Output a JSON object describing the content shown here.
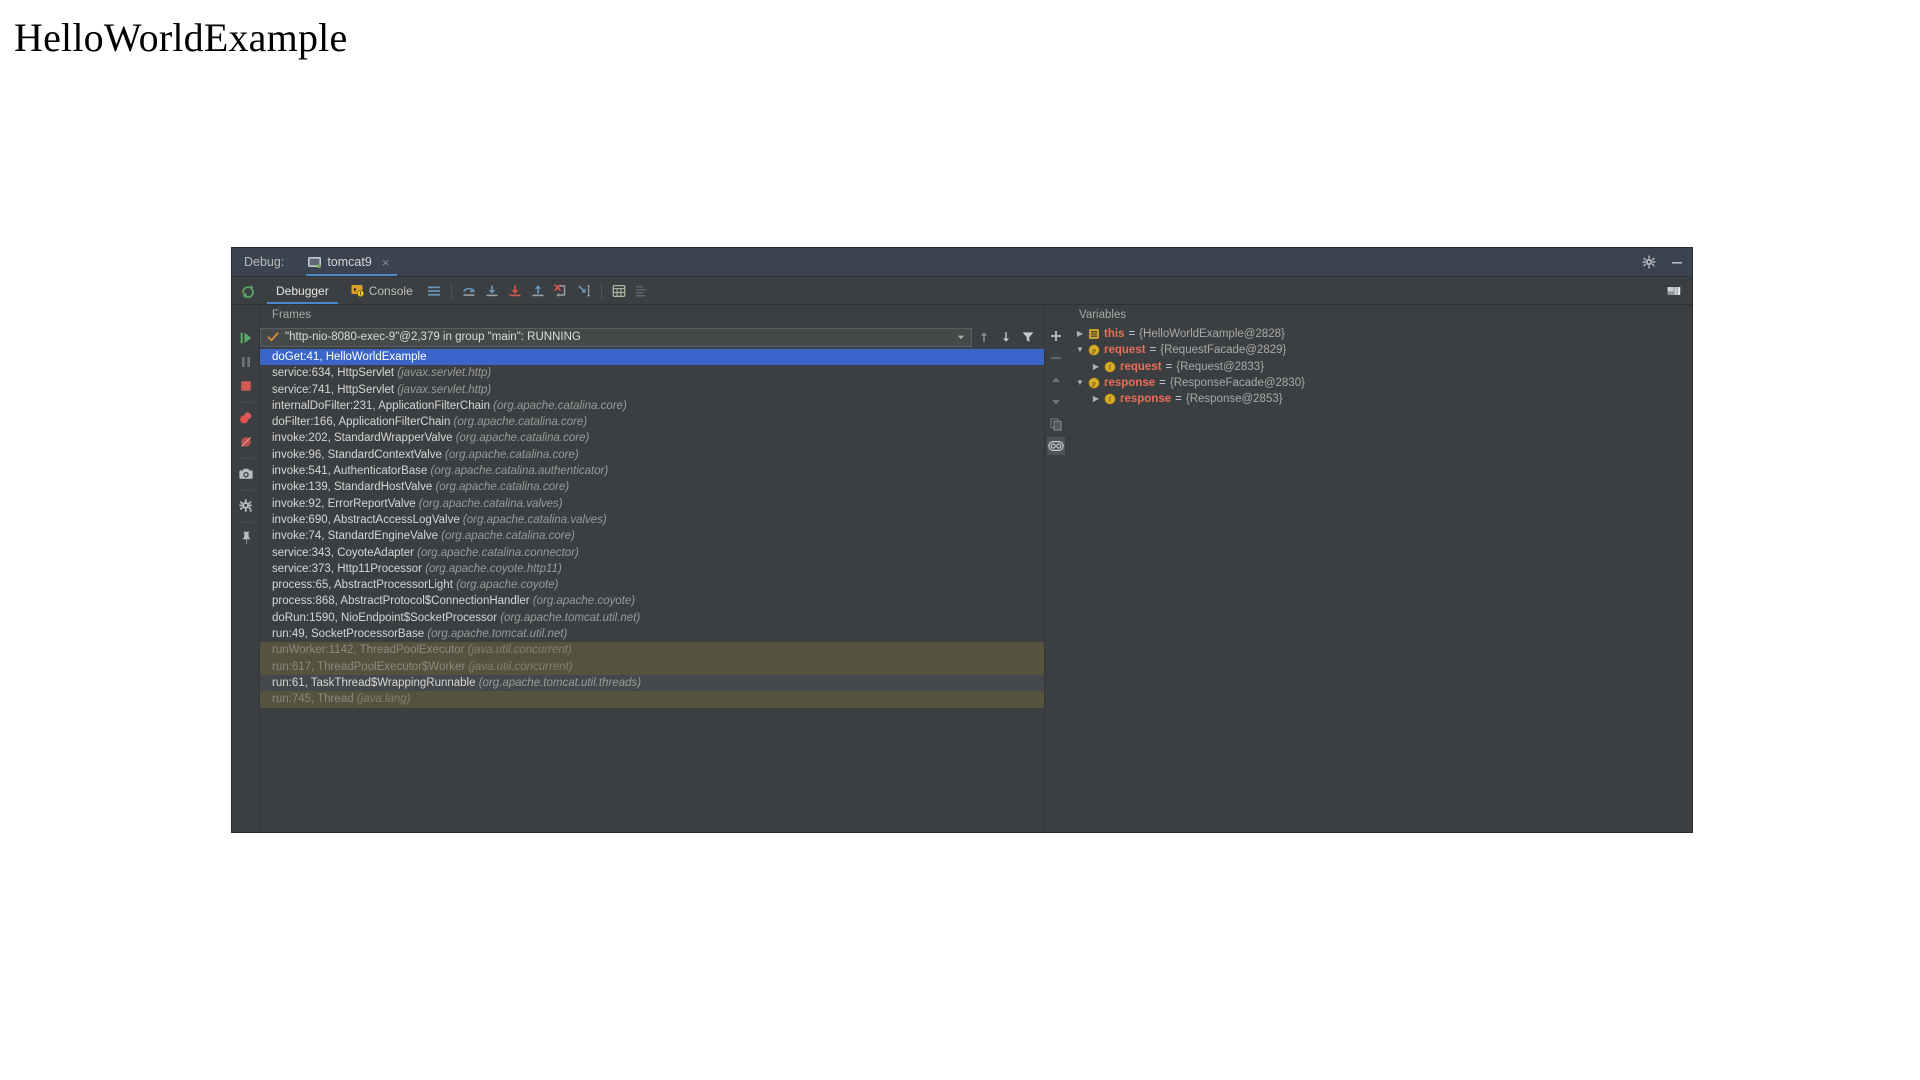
{
  "page": {
    "title": "HelloWorldExample"
  },
  "colors": {
    "accent_blue": "#4a88c7",
    "selection_blue": "#3a64c8",
    "panel_bg": "#3c3f41",
    "header_bg": "#3c4350",
    "var_name": "#e8705a",
    "library_row": "#55523f"
  },
  "window": {
    "header": {
      "debug_label": "Debug:",
      "run_tab_label": "tomcat9",
      "tab_close_glyph": "×",
      "settings_icon": "gear-icon",
      "minimize_icon": "minimize-icon"
    },
    "toolbar": {
      "rerun_icon": "rerun-icon",
      "tabs": [
        {
          "label": "Debugger",
          "icon": "",
          "active": true
        },
        {
          "label": "Console",
          "icon": "console-icon",
          "active": false
        }
      ],
      "icons": [
        "layout-lines-icon",
        "step-over-icon",
        "step-into-icon",
        "force-step-into-icon",
        "step-out-icon",
        "drop-frame-icon",
        "run-to-cursor-icon",
        "evaluate-expression-icon",
        "mute-breakpoints-icon"
      ],
      "right_icon": "restore-layout-icon"
    },
    "side_actions": [
      "resume-program-icon",
      "pause-program-icon",
      "stop-icon",
      "view-breakpoints-icon",
      "mute-breakpoints-icon",
      "snapshot-icon",
      "settings-icon",
      "pin-tab-icon"
    ]
  },
  "frames": {
    "title": "Frames",
    "thread": {
      "status_icon": "running-check-icon",
      "value": "\"http-nio-8080-exec-9\"@2,379 in group \"main\": RUNNING",
      "dropdown_icon": "chevron-down-icon",
      "buttons": [
        "arrow-up-icon",
        "arrow-down-icon",
        "filter-icon"
      ]
    },
    "rows": [
      {
        "method": "doGet:41, HelloWorldExample",
        "package": "",
        "state": "selected"
      },
      {
        "method": "service:634, HttpServlet",
        "package": "(javax.servlet.http)",
        "state": "normal"
      },
      {
        "method": "service:741, HttpServlet",
        "package": "(javax.servlet.http)",
        "state": "normal"
      },
      {
        "method": "internalDoFilter:231, ApplicationFilterChain",
        "package": "(org.apache.catalina.core)",
        "state": "normal"
      },
      {
        "method": "doFilter:166, ApplicationFilterChain",
        "package": "(org.apache.catalina.core)",
        "state": "normal"
      },
      {
        "method": "invoke:202, StandardWrapperValve",
        "package": "(org.apache.catalina.core)",
        "state": "normal"
      },
      {
        "method": "invoke:96, StandardContextValve",
        "package": "(org.apache.catalina.core)",
        "state": "normal"
      },
      {
        "method": "invoke:541, AuthenticatorBase",
        "package": "(org.apache.catalina.authenticator)",
        "state": "normal"
      },
      {
        "method": "invoke:139, StandardHostValve",
        "package": "(org.apache.catalina.core)",
        "state": "normal"
      },
      {
        "method": "invoke:92, ErrorReportValve",
        "package": "(org.apache.catalina.valves)",
        "state": "normal"
      },
      {
        "method": "invoke:690, AbstractAccessLogValve",
        "package": "(org.apache.catalina.valves)",
        "state": "normal"
      },
      {
        "method": "invoke:74, StandardEngineValve",
        "package": "(org.apache.catalina.core)",
        "state": "normal"
      },
      {
        "method": "service:343, CoyoteAdapter",
        "package": "(org.apache.catalina.connector)",
        "state": "normal"
      },
      {
        "method": "service:373, Http11Processor",
        "package": "(org.apache.coyote.http11)",
        "state": "normal"
      },
      {
        "method": "process:65, AbstractProcessorLight",
        "package": "(org.apache.coyote)",
        "state": "normal"
      },
      {
        "method": "process:868, AbstractProtocol$ConnectionHandler",
        "package": "(org.apache.coyote)",
        "state": "normal"
      },
      {
        "method": "doRun:1590, NioEndpoint$SocketProcessor",
        "package": "(org.apache.tomcat.util.net)",
        "state": "normal"
      },
      {
        "method": "run:49, SocketProcessorBase",
        "package": "(org.apache.tomcat.util.net)",
        "state": "normal"
      },
      {
        "method": "runWorker:1142, ThreadPoolExecutor",
        "package": "(java.util.concurrent)",
        "state": "library"
      },
      {
        "method": "run:617, ThreadPoolExecutor$Worker",
        "package": "(java.util.concurrent)",
        "state": "library"
      },
      {
        "method": "run:61, TaskThread$WrappingRunnable",
        "package": "(org.apache.tomcat.util.threads)",
        "state": "highlight"
      },
      {
        "method": "run:745, Thread",
        "package": "(java.lang)",
        "state": "library"
      }
    ]
  },
  "variables": {
    "title": "Variables",
    "actions": [
      "add-watch-icon",
      "remove-watch-icon",
      "move-up-icon",
      "move-down-icon",
      "copy-icon",
      "inspect-icon"
    ],
    "rows": [
      {
        "indent": 0,
        "expander": "▶",
        "badge": "static-field-icon",
        "badge_glyph": "≡",
        "name": "this",
        "eq": "=",
        "value": "{HelloWorldExample@2828}"
      },
      {
        "indent": 0,
        "expander": "▼",
        "badge": "parameter-icon",
        "badge_glyph": "p",
        "name": "request",
        "eq": "=",
        "value": "{RequestFacade@2829}"
      },
      {
        "indent": 1,
        "expander": "▶",
        "badge": "field-icon",
        "badge_glyph": "f",
        "name": "request",
        "eq": "=",
        "value": "{Request@2833}"
      },
      {
        "indent": 0,
        "expander": "▼",
        "badge": "parameter-icon",
        "badge_glyph": "p",
        "name": "response",
        "eq": "=",
        "value": "{ResponseFacade@2830}"
      },
      {
        "indent": 1,
        "expander": "▶",
        "badge": "field-icon",
        "badge_glyph": "f",
        "name": "response",
        "eq": "=",
        "value": "{Response@2853}"
      }
    ]
  }
}
